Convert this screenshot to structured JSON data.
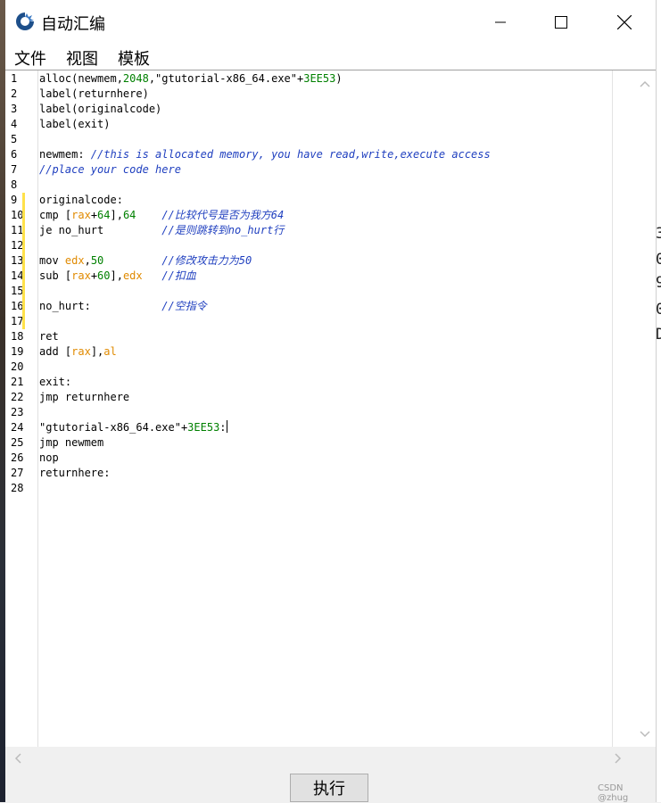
{
  "window": {
    "title": "自动汇编"
  },
  "menu": [
    "文件",
    "视图",
    "模板"
  ],
  "editor": {
    "line_numbers": [
      "1",
      "2",
      "3",
      "4",
      "5",
      "6",
      "7",
      "8",
      "9",
      "10",
      "11",
      "12",
      "13",
      "14",
      "15",
      "16",
      "17",
      "18",
      "19",
      "20",
      "21",
      "22",
      "23",
      "24",
      "25",
      "26",
      "27",
      "28"
    ],
    "modified_line_marker": "#ffe14a",
    "lines": [
      [
        {
          "t": "alloc(newmem,",
          "c": "kw"
        },
        {
          "t": "2048",
          "c": "num"
        },
        {
          "t": ",\"gtutorial-x86_64.exe\"+",
          "c": "kw"
        },
        {
          "t": "3EE53",
          "c": "num"
        },
        {
          "t": ")",
          "c": "kw"
        }
      ],
      [
        {
          "t": "label(returnhere)",
          "c": "kw"
        }
      ],
      [
        {
          "t": "label(originalcode)",
          "c": "kw"
        }
      ],
      [
        {
          "t": "label(exit)",
          "c": "kw"
        }
      ],
      [],
      [
        {
          "t": "newmem: ",
          "c": "kw"
        },
        {
          "t": "//this is allocated memory, you have read,write,execute access",
          "c": "cm"
        }
      ],
      [
        {
          "t": "//place your code here",
          "c": "cm"
        }
      ],
      [],
      [
        {
          "t": "originalcode:",
          "c": "kw"
        }
      ],
      [
        {
          "t": "cmp [",
          "c": "kw"
        },
        {
          "t": "rax",
          "c": "reg"
        },
        {
          "t": "+",
          "c": "kw"
        },
        {
          "t": "64",
          "c": "num"
        },
        {
          "t": "],",
          "c": "kw"
        },
        {
          "t": "64",
          "c": "num"
        },
        {
          "t": "    ",
          "c": "kw"
        },
        {
          "t": "//比较代号是否为我方64",
          "c": "cm"
        }
      ],
      [
        {
          "t": "je no_hurt         ",
          "c": "kw"
        },
        {
          "t": "//是则跳转到no_hurt行",
          "c": "cm"
        }
      ],
      [],
      [
        {
          "t": "mov ",
          "c": "kw"
        },
        {
          "t": "edx",
          "c": "reg"
        },
        {
          "t": ",",
          "c": "kw"
        },
        {
          "t": "50",
          "c": "num"
        },
        {
          "t": "         ",
          "c": "kw"
        },
        {
          "t": "//修改攻击力为50",
          "c": "cm"
        }
      ],
      [
        {
          "t": "sub [",
          "c": "kw"
        },
        {
          "t": "rax",
          "c": "reg"
        },
        {
          "t": "+",
          "c": "kw"
        },
        {
          "t": "60",
          "c": "num"
        },
        {
          "t": "],",
          "c": "kw"
        },
        {
          "t": "edx",
          "c": "reg"
        },
        {
          "t": "   ",
          "c": "kw"
        },
        {
          "t": "//扣血",
          "c": "cm"
        }
      ],
      [],
      [
        {
          "t": "no_hurt:           ",
          "c": "kw"
        },
        {
          "t": "//空指令",
          "c": "cm"
        }
      ],
      [],
      [
        {
          "t": "ret",
          "c": "kw"
        }
      ],
      [
        {
          "t": "add [",
          "c": "kw"
        },
        {
          "t": "rax",
          "c": "reg"
        },
        {
          "t": "],",
          "c": "kw"
        },
        {
          "t": "al",
          "c": "reg"
        }
      ],
      [],
      [
        {
          "t": "exit:",
          "c": "kw"
        }
      ],
      [
        {
          "t": "jmp returnhere",
          "c": "kw"
        }
      ],
      [],
      [
        {
          "t": "\"gtutorial-x86_64.exe\"+",
          "c": "kw"
        },
        {
          "t": "3EE53",
          "c": "num"
        },
        {
          "t": ":",
          "c": "kw"
        }
      ],
      [
        {
          "t": "jmp newmem",
          "c": "kw"
        }
      ],
      [
        {
          "t": "nop",
          "c": "kw"
        }
      ],
      [
        {
          "t": "returnhere:",
          "c": "kw"
        }
      ],
      []
    ]
  },
  "execute_button": "执行",
  "watermark": "CSDN @zhug",
  "background_fragments": [
    "3",
    "0",
    "9",
    "0",
    "D"
  ]
}
